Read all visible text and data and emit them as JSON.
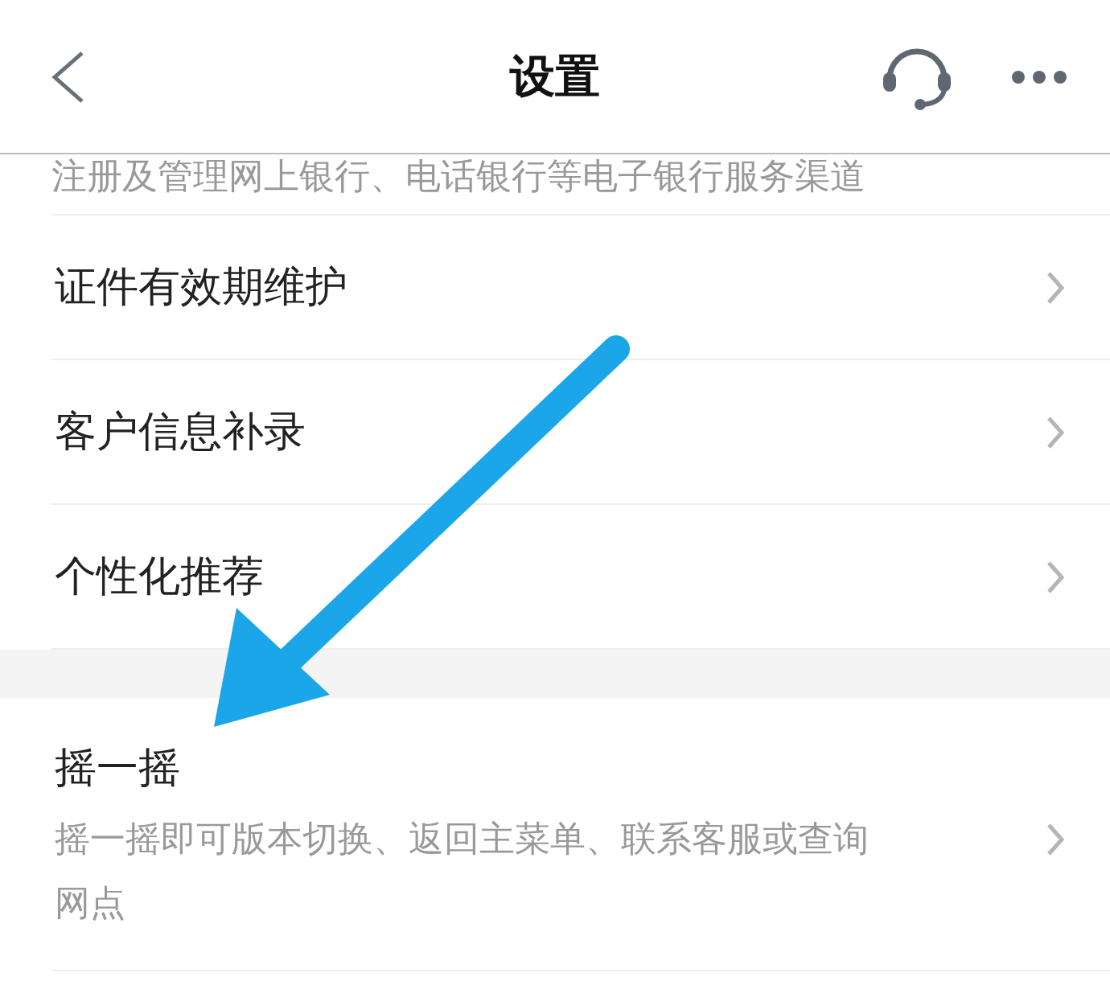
{
  "header": {
    "title": "设置"
  },
  "top_note": "注册及管理网上银行、电话银行等电子银行服务渠道",
  "groups": [
    {
      "items": [
        {
          "title": "证件有效期维护"
        },
        {
          "title": "客户信息补录"
        },
        {
          "title": "个性化推荐"
        }
      ]
    },
    {
      "items": [
        {
          "title": "摇一摇",
          "description": "摇一摇即可版本切换、返回主菜单、联系客服或查询网点"
        }
      ]
    }
  ]
}
